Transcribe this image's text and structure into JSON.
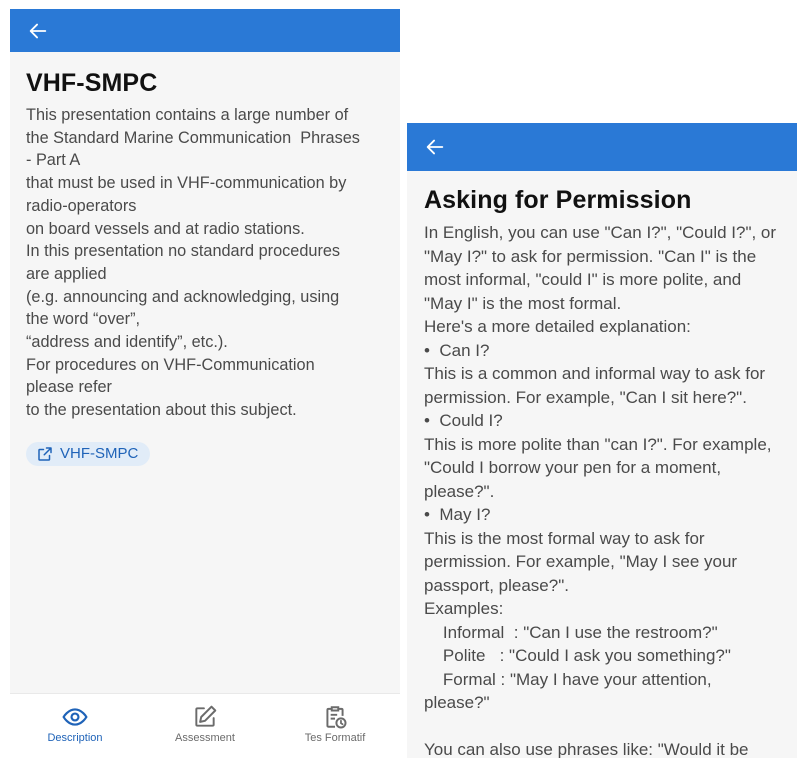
{
  "colors": {
    "appbar": "#2a79d6",
    "accent": "#1f63b8",
    "chip_bg": "#e1ecf8"
  },
  "left": {
    "title": "VHF-SMPC",
    "lines": [
      "This presentation contains a large number of",
      "the Standard Marine Communication  Phrases",
      "- Part A",
      "that must be used in VHF-communication by",
      "radio-operators",
      "on board vessels and at radio stations.",
      "In this presentation no standard procedures",
      "are applied",
      "(e.g. announcing and acknowledging, using",
      "the word “over”,",
      "“address and identify”, etc.).",
      "For procedures on VHF-Communication",
      "please refer",
      "to the presentation about this subject."
    ],
    "link_label": "VHF-SMPC",
    "nav": [
      {
        "label": "Description",
        "icon": "eye-icon",
        "active": true
      },
      {
        "label": "Assessment",
        "icon": "edit-icon",
        "active": false
      },
      {
        "label": "Tes Formatif",
        "icon": "clipboard-clock-icon",
        "active": false
      }
    ]
  },
  "right": {
    "title": "Asking for Permission",
    "lines": [
      "In English, you can use \"Can I?\", \"Could I?\", or",
      "\"May I?\" to ask for permission. \"Can I\" is the",
      "most informal, \"could I\" is more polite, and",
      "\"May I\" is the most formal.",
      "Here's a more detailed explanation:",
      "•  Can I?",
      "This is a common and informal way to ask for",
      "permission. For example, \"Can I sit here?\".",
      "•  Could I?",
      "This is more polite than \"can I?\". For example,",
      "\"Could I borrow your pen for a moment,",
      "please?\".",
      "•  May I?",
      "This is the most formal way to ask for",
      "permission. For example, \"May I see your",
      "passport, please?\".",
      "Examples:",
      "    Informal  : \"Can I use the restroom?\"",
      "    Polite   : \"Could I ask you something?\"",
      "    Formal : \"May I have your attention,",
      "please?\"",
      " ",
      "You can also use phrases like: \"Would it be"
    ]
  }
}
